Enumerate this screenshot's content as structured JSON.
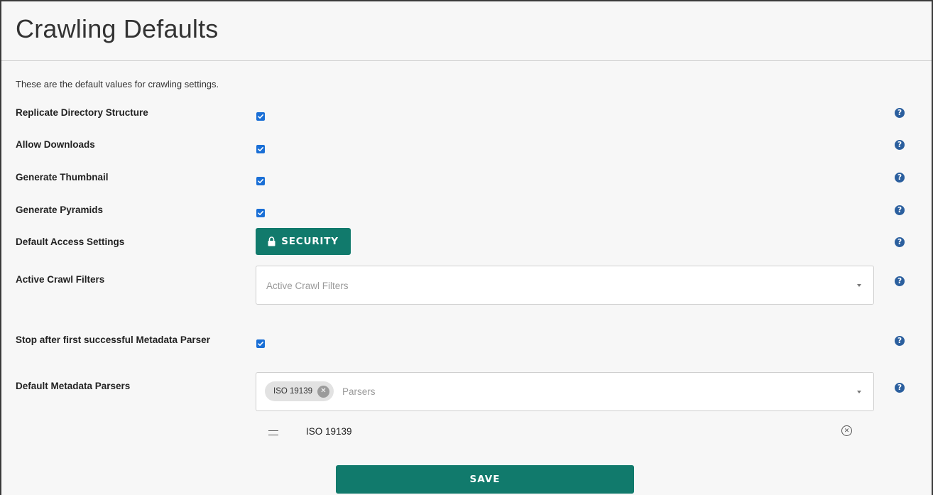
{
  "page": {
    "title": "Crawling Defaults",
    "description": "These are the default values for crawling settings."
  },
  "settings": {
    "replicate_directory_structure": {
      "label": "Replicate Directory Structure",
      "checked": true
    },
    "allow_downloads": {
      "label": "Allow Downloads",
      "checked": true
    },
    "generate_thumbnail": {
      "label": "Generate Thumbnail",
      "checked": true
    },
    "generate_pyramids": {
      "label": "Generate Pyramids",
      "checked": true
    },
    "default_access_settings": {
      "label": "Default Access Settings",
      "button_label": "SECURITY",
      "button_icon": "lock-icon"
    },
    "active_crawl_filters": {
      "label": "Active Crawl Filters",
      "placeholder": "Active Crawl Filters"
    },
    "stop_after_first_parser": {
      "label": "Stop after first successful Metadata Parser",
      "checked": true
    },
    "default_metadata_parsers": {
      "label": "Default Metadata Parsers",
      "placeholder": "Parsers",
      "selected_tags": [
        "ISO 19139"
      ],
      "list_items": [
        "ISO 19139"
      ]
    }
  },
  "help_icon": {
    "glyph": "?"
  },
  "actions": {
    "save_label": "SAVE"
  },
  "colors": {
    "primary": "#117a6c",
    "help": "#2b5f9e",
    "checkbox": "#1a6fd6"
  }
}
